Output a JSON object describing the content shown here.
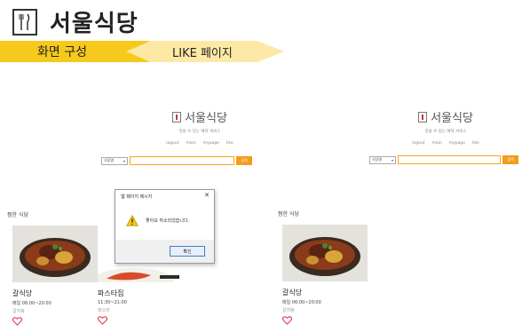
{
  "slide": {
    "title": "서울식당",
    "ribbon_left": "화면 구성",
    "ribbon_right": "LIKE 페이지",
    "ribbon_color": "#f7c91d"
  },
  "left_page": {
    "brand": "서울식당",
    "tagline": "맛을 수 있는 예약 서비스",
    "nav": [
      "logout",
      "main",
      "mypage",
      "like"
    ],
    "search": {
      "select_value": "식당명",
      "button": "검색"
    },
    "section_label": "찜한 식당",
    "cards": [
      {
        "name": "갈식당",
        "hours": "매일 06:00~20:00",
        "category": "갈치탕"
      },
      {
        "name": "파스타집",
        "hours": "11:30~21:00",
        "category": "파스타"
      }
    ],
    "dialog": {
      "title": "웹 페이지 메시지",
      "message": "좋아요 취소되었습니다.",
      "ok": "확인"
    }
  },
  "right_page": {
    "brand": "서울식당",
    "tagline": "맛을 수 있는 예약 서비스",
    "nav": [
      "logout",
      "main",
      "mypage",
      "like"
    ],
    "search": {
      "select_value": "식당명",
      "button": "검색"
    },
    "section_label": "찜한 식당",
    "cards": [
      {
        "name": "갈식당",
        "hours": "매일 06:00~20:00",
        "category": "갈치탕"
      }
    ]
  },
  "colors": {
    "accent": "#f39c1e",
    "heart": "#e23b4f"
  }
}
